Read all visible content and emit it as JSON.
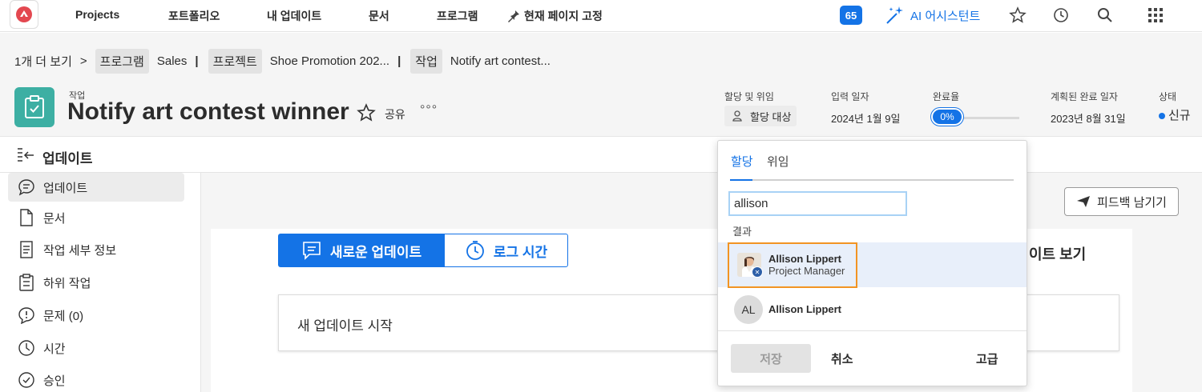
{
  "nav": {
    "items": [
      "Projects",
      "포트폴리오",
      "내 업데이트",
      "문서",
      "프로그램"
    ],
    "pin_label": "현재 페이지 고정",
    "badge_count": "65",
    "ai_label": "AI 어시스턴트"
  },
  "breadcrumb": {
    "more": "1개 더 보기",
    "chevron": ">",
    "program_chip": "프로그램",
    "program_name": "Sales",
    "project_chip": "프로젝트",
    "project_name": "Shoe Promotion 202...",
    "task_chip": "작업",
    "task_name": "Notify art contest...",
    "sep": "|"
  },
  "task": {
    "type_label": "작업",
    "title": "Notify art contest winner",
    "share_label": "공유",
    "more_label": "°°°"
  },
  "meta": {
    "assign_label": "할당 및 위임",
    "assign_value": "할당 대상",
    "entry_label": "입력 일자",
    "entry_value": "2024년 1월 9일",
    "complete_label": "완료율",
    "complete_value": "0%",
    "complete_fraction": 0,
    "planned_label": "계획된 완료 일자",
    "planned_value": "2023년 8월 31일",
    "status_label": "상태",
    "status_value": "신규"
  },
  "updates": {
    "title": "업데이트",
    "new_update_btn": "새로운 업데이트",
    "log_time_btn": "로그 시간",
    "new_update_placeholder": "새 업데이트 시작",
    "feedback_btn": "피드백 남기기",
    "view_text": "이트 보기"
  },
  "sidebar": {
    "items": [
      {
        "label": "업데이트",
        "icon": "chat-bubble-icon"
      },
      {
        "label": "문서",
        "icon": "document-icon"
      },
      {
        "label": "작업 세부 정보",
        "icon": "details-icon"
      },
      {
        "label": "하위 작업",
        "icon": "subtask-icon"
      },
      {
        "label": "문제 (0)",
        "icon": "issue-icon"
      },
      {
        "label": "시간",
        "icon": "clock-icon"
      },
      {
        "label": "승인",
        "icon": "approval-icon"
      }
    ]
  },
  "popover": {
    "tab_assign": "할당",
    "tab_delegate": "위임",
    "search_value": "allison",
    "results_label": "결과",
    "results": [
      {
        "name": "Allison Lippert",
        "role": "Project Manager"
      },
      {
        "name": "Allison Lippert",
        "initials": "AL"
      }
    ],
    "save_btn": "저장",
    "cancel_btn": "취소",
    "advanced_btn": "고급"
  },
  "colors": {
    "accent": "#1473e6",
    "task_icon_bg": "#3dafa3",
    "highlight": "#f29423"
  }
}
